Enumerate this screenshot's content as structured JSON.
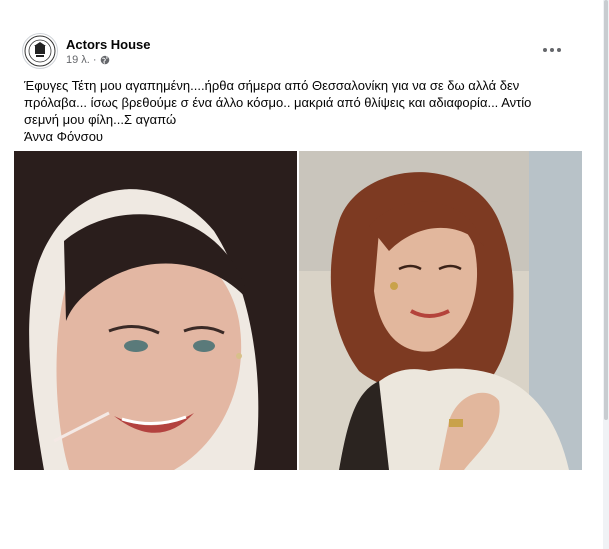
{
  "post": {
    "page_name": "Actors House",
    "timestamp": "19 λ.",
    "audience_icon": "globe-icon",
    "more_icon": "more-horizontal-icon",
    "text_lines": [
      "Έφυγες Τέτη μου αγαπημένη....ήρθα σήμερα από Θεσσαλονίκη για να σε δω αλλά δεν",
      "πρόλαβα... ίσως βρεθούμε σ ένα άλλο κόσμο.. μακριά από θλίψεις και αδιαφορία... Αντίο",
      "σεμνή μου φίλη...Σ αγαπώ",
      "Άννα Φόνσου"
    ]
  },
  "colors": {
    "text": "#050505",
    "muted": "#65676b",
    "border": "#dcdfe3"
  }
}
